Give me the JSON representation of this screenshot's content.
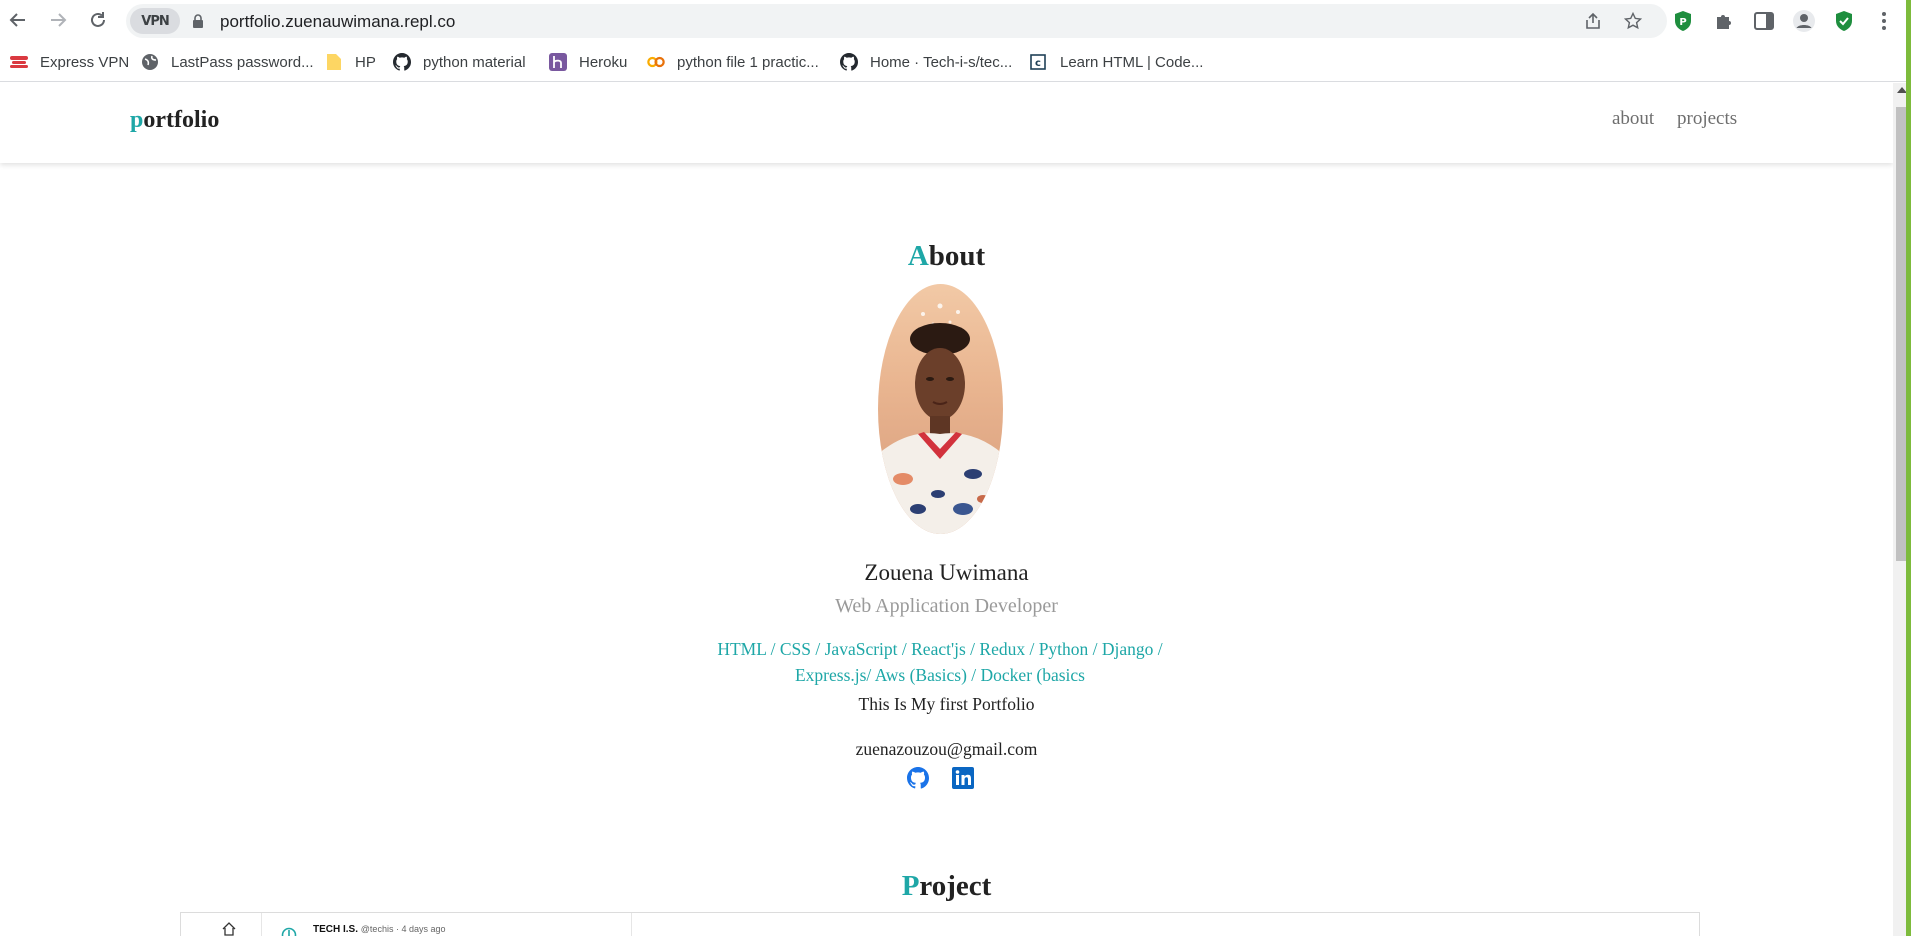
{
  "browser": {
    "url": "portfolio.zuenauwimana.repl.co",
    "vpn_label": "VPN"
  },
  "bookmarks": [
    {
      "label": "Express VPN",
      "icon": "expressvpn-icon"
    },
    {
      "label": "LastPass password...",
      "icon": "globe-icon"
    },
    {
      "label": "HP",
      "icon": "folder-icon"
    },
    {
      "label": "python material",
      "icon": "github-icon"
    },
    {
      "label": "Heroku",
      "icon": "heroku-icon"
    },
    {
      "label": "python file 1 practic...",
      "icon": "colab-icon"
    },
    {
      "label": "Home · Tech-i-s/tec...",
      "icon": "github-icon"
    },
    {
      "label": "Learn HTML | Code...",
      "icon": "codecademy-icon"
    }
  ],
  "site": {
    "logo_first": "p",
    "logo_rest": "ortfolio",
    "nav": [
      {
        "label": "about"
      },
      {
        "label": "projects"
      }
    ]
  },
  "about": {
    "title_first": "A",
    "title_rest": "bout",
    "name": "Zouena Uwimana",
    "role": "Web Application Developer",
    "skills_line1": "HTML / CSS / JavaScript / React'js / Redux / Python / Django /",
    "skills_line2": "Express.js/ Aws (Basics) / Docker (basics",
    "tagline": "This Is My first Portfolio",
    "email": "zuenazouzou@gmail.com",
    "social": [
      {
        "icon": "github-icon"
      },
      {
        "icon": "linkedin-icon"
      }
    ]
  },
  "projects": {
    "title_first": "P",
    "title_rest": "roject",
    "preview_author": "TECH I.S.",
    "preview_meta": "@techis · 4 days ago"
  },
  "colors": {
    "accent": "#1ea7a7",
    "linkedin": "#0a66c2",
    "github_social": "#1a73e8"
  }
}
